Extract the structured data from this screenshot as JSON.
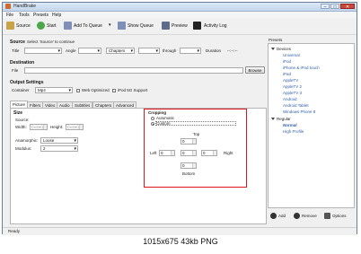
{
  "window": {
    "title": "HandBrake"
  },
  "menu": [
    "File",
    "Tools",
    "Presets",
    "Help"
  ],
  "toolbar": {
    "source": "Source",
    "start": "Start",
    "add_to_queue": "Add To Queue",
    "show_queue": "Show Queue",
    "preview": "Preview",
    "activity_log": "Activity Log"
  },
  "source_section": {
    "label": "Source",
    "hint": "Select 'Source' to continue",
    "title_label": "Title",
    "angle_label": "Angle",
    "chapters_value": "Chapters",
    "through_label": "through",
    "duration_label": "Duration",
    "duration_value": "--:--:--"
  },
  "destination": {
    "label": "Destination",
    "file_label": "File",
    "browse": "Browse"
  },
  "output_settings": {
    "label": "Output Settings",
    "container_label": "Container",
    "container_value": "Mp4",
    "web_optimized": "Web Optimized",
    "ipod_support": "iPod 5G Support"
  },
  "tabs": [
    "Picture",
    "Filters",
    "Video",
    "Audio",
    "Subtitles",
    "Chapters",
    "Advanced"
  ],
  "picture": {
    "size_label": "Size",
    "source_label": "Source:",
    "width_label": "Width:",
    "height_label": "Height:",
    "width_value": "(none)",
    "height_value": "(none)",
    "anamorphic_label": "Anamorphic:",
    "anamorphic_value": "Loose",
    "modulus_label": "Modulus:",
    "modulus_value": "2",
    "cropping_label": "Cropping",
    "automatic": "Automatic",
    "custom": "Custom",
    "top_label": "Top",
    "left_label": "Left",
    "right_label": "Right",
    "bottom_label": "Bottom",
    "top_value": "0",
    "left_value": "0",
    "right_value": "0",
    "bottom_value": "0",
    "mid_left_value": "0",
    "mid_right_value": "0"
  },
  "presets": {
    "label": "Presets",
    "groups": [
      {
        "name": "Devices",
        "items": [
          "Universal",
          "iPod",
          "iPhone & iPod touch",
          "iPad",
          "AppleTV",
          "AppleTV 2",
          "AppleTV 3",
          "Android",
          "Android Tablet",
          "Windows Phone 8"
        ]
      },
      {
        "name": "Regular",
        "items": [
          "Normal",
          "High Profile"
        ]
      }
    ],
    "add": "Add",
    "remove": "Remove",
    "options": "Options"
  },
  "status": "Ready",
  "caption": "1015x675 43kb PNG",
  "colors": {
    "highlight": "#e0141c",
    "preset_link": "#2f5ea9"
  }
}
